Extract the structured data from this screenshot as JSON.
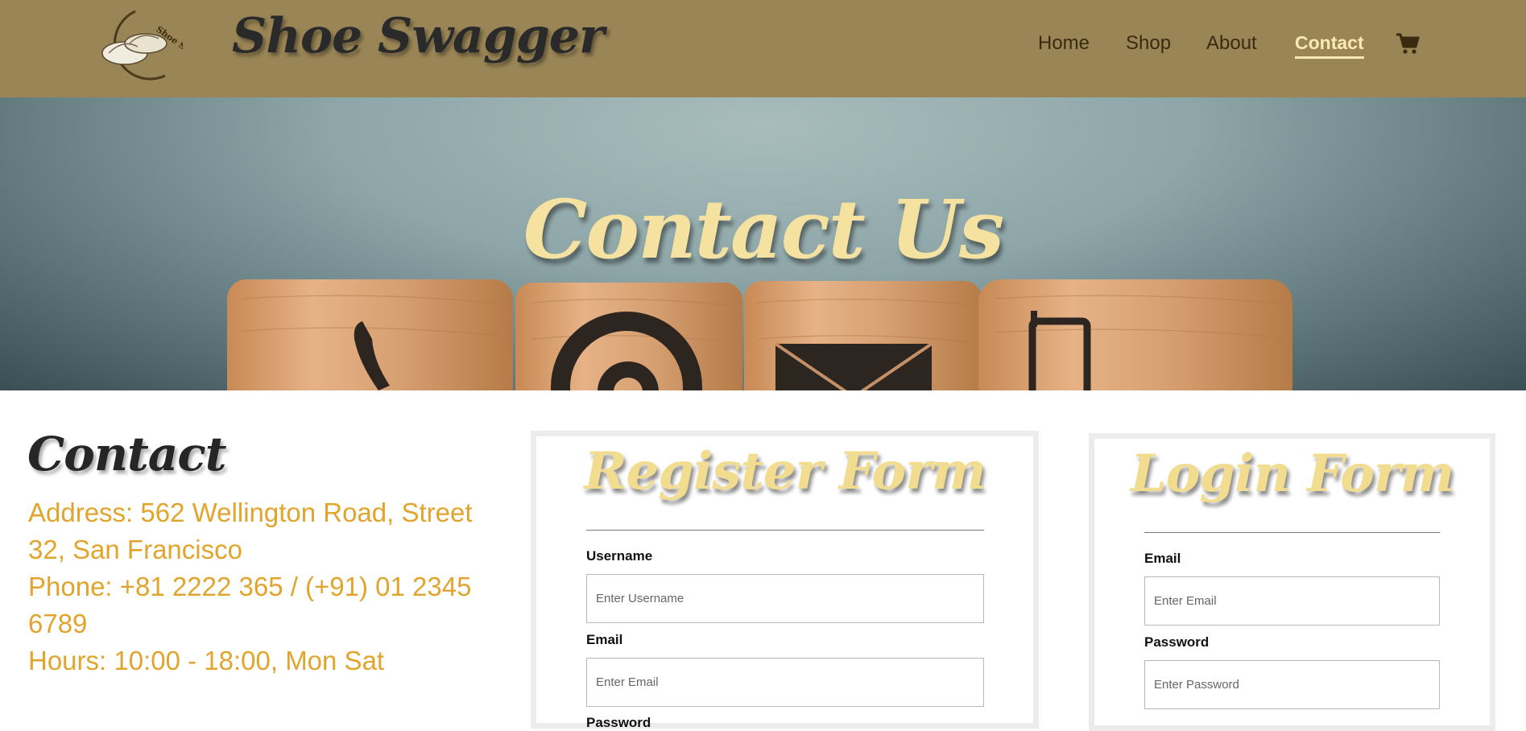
{
  "header": {
    "logo_text": "Shoe Swagger",
    "brand": "Shoe Swagger",
    "background": "#9a8556",
    "nav": [
      {
        "label": "Home"
      },
      {
        "label": "Shop"
      },
      {
        "label": "About"
      },
      {
        "label": "Contact",
        "active": true
      }
    ],
    "cart_icon": "shopping-cart-icon"
  },
  "hero": {
    "title": "Contact Us",
    "image": "wooden blocks with phone, at-sign, envelope and mobile icons",
    "icons": [
      "phone-icon",
      "at-sign-icon",
      "envelope-icon",
      "mobile-phone-icon"
    ]
  },
  "contact": {
    "heading": "Contact",
    "address": "Address: 562 Wellington Road, Street 32, San Francisco",
    "phone": "Phone: +81 2222 365 / (+91) 01 2345 6789",
    "hours": "Hours: 10:00 - 18:00, Mon Sat",
    "text_color": "#e1a42c"
  },
  "register_form": {
    "title": "Register Form",
    "fields": [
      {
        "label": "Username",
        "placeholder": "Enter Username"
      },
      {
        "label": "Email",
        "placeholder": "Enter Email"
      },
      {
        "label": "Password"
      }
    ]
  },
  "login_form": {
    "title": "Login Form",
    "fields": [
      {
        "label": "Email",
        "placeholder": "Enter Email"
      },
      {
        "label": "Password",
        "placeholder": "Enter Password"
      }
    ]
  },
  "colors": {
    "accent_gold": "#f2dc90",
    "nav_active": "#fbe9b4",
    "nav_text": "#3a2a10"
  }
}
